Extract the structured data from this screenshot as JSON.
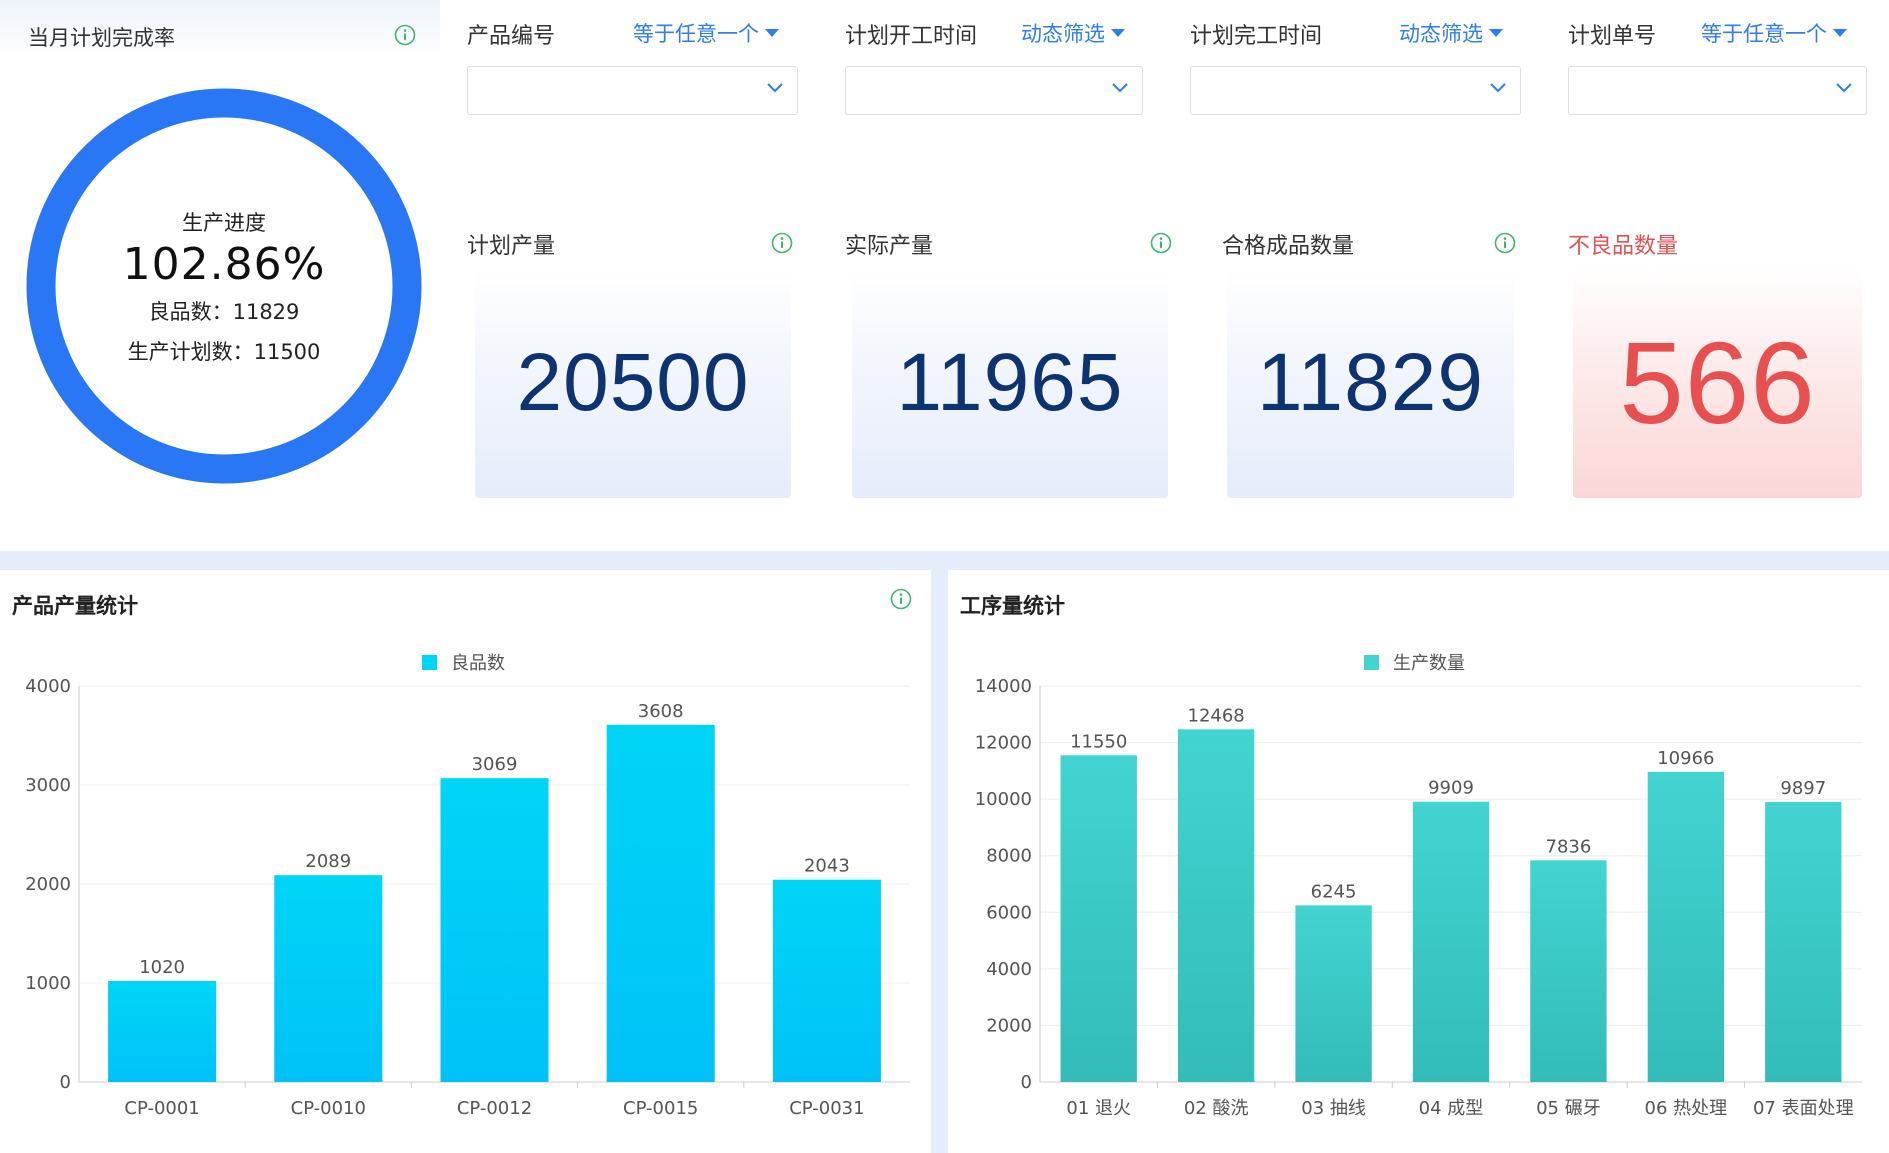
{
  "ring": {
    "title": "当月计划完成率",
    "label": "生产进度",
    "percent": "102.86%",
    "good_line": "良品数：11829",
    "plan_line": "生产计划数：11500",
    "ring_color": "#2a77f6",
    "progress": 1.0286
  },
  "filters": [
    {
      "label": "产品编号",
      "mode": "等于任意一个",
      "value": ""
    },
    {
      "label": "计划开工时间",
      "mode": "动态筛选",
      "value": ""
    },
    {
      "label": "计划完工时间",
      "mode": "动态筛选",
      "value": ""
    },
    {
      "label": "计划单号",
      "mode": "等于任意一个",
      "value": ""
    }
  ],
  "kpis": [
    {
      "label": "计划产量",
      "value": "20500"
    },
    {
      "label": "实际产量",
      "value": "11965"
    },
    {
      "label": "合格成品数量",
      "value": "11829"
    },
    {
      "label": "不良品数量",
      "value": "566",
      "color": "#e85050"
    }
  ],
  "colors": {
    "accent": "#2f7df6",
    "info_icon": "#3fb66b",
    "kpi_number": "#0e3372",
    "bar_cyan_top": "#00d5f7",
    "bar_cyan_bottom": "#00c2f8",
    "bar_teal_top": "#42d4d1",
    "bar_teal_bottom": "#33bcb9"
  },
  "chart_data": [
    {
      "type": "bar",
      "title": "产品产量统计",
      "legend": "top-center",
      "grid": true,
      "categories": [
        "CP-0001",
        "CP-0010",
        "CP-0012",
        "CP-0015",
        "CP-0031"
      ],
      "series": [
        {
          "name": "良品数",
          "values": [
            1020,
            2089,
            3069,
            3608,
            2043
          ]
        }
      ],
      "ylim": [
        0,
        4000
      ],
      "yticks": [
        0,
        1000,
        2000,
        3000,
        4000
      ]
    },
    {
      "type": "bar",
      "title": "工序量统计",
      "legend": "top-center",
      "grid": true,
      "categories": [
        "01 退火",
        "02 酸洗",
        "03 抽线",
        "04 成型",
        "05 碾牙",
        "06 热处理",
        "07 表面处理"
      ],
      "series": [
        {
          "name": "生产数量",
          "values": [
            11550,
            12468,
            6245,
            9909,
            7836,
            10966,
            9897
          ]
        }
      ],
      "ylim": [
        0,
        14000
      ],
      "yticks": [
        0,
        2000,
        4000,
        6000,
        8000,
        10000,
        12000,
        14000
      ]
    }
  ]
}
